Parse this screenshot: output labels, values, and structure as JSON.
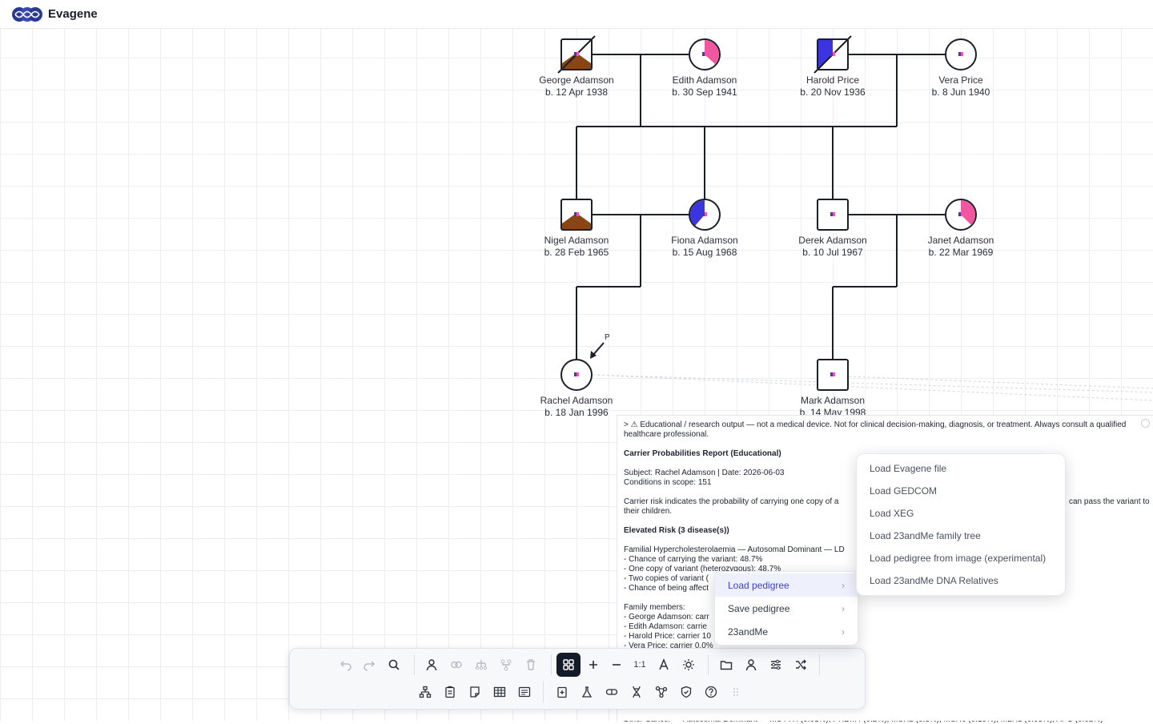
{
  "app": {
    "title": "Evagene"
  },
  "colors": {
    "accent": "#3a3fcf",
    "carrier_blue": "#3b35e0",
    "carrier_pink": "#f0579e",
    "affected_brown": "#8a4514",
    "line": "#1b1f2a"
  },
  "pedigree": {
    "people": [
      {
        "name": "George Adamson",
        "birth": "b. 12 Apr 1938"
      },
      {
        "name": "Edith Adamson",
        "birth": "b. 30 Sep 1941"
      },
      {
        "name": "Harold Price",
        "birth": "b. 20 Nov 1936"
      },
      {
        "name": "Vera Price",
        "birth": "b. 8 Jun 1940"
      },
      {
        "name": "Nigel Adamson",
        "birth": "b. 28 Feb 1965"
      },
      {
        "name": "Fiona Adamson",
        "birth": "b. 15 Aug 1968"
      },
      {
        "name": "Derek Adamson",
        "birth": "b. 10 Jul 1967"
      },
      {
        "name": "Janet Adamson",
        "birth": "b. 22 Mar 1969"
      },
      {
        "name": "Rachel Adamson",
        "birth": "b. 18 Jan 1996"
      },
      {
        "name": "Mark Adamson",
        "birth": "b. 14 May 1998"
      }
    ],
    "proband_marker": "P"
  },
  "report": {
    "disclaimer": "> ⚠ Educational / research output — not a medical device. Not for clinical decision-making, diagnosis, or treatment. Always consult a qualified healthcare professional.",
    "title": "Carrier Probabilities Report (Educational)",
    "subject": "Subject: Rachel Adamson | Date: 2026-06-03",
    "scope": "Conditions in scope: 151",
    "explain_1": "Carrier risk indicates the probability of carrying one copy of a",
    "explain_2": "can pass the variant to",
    "explain_3": "their children.",
    "elevated": "Elevated Risk (3 disease(s))",
    "fh_line": "Familial Hypercholesterolaemia — Autosomal Dominant — LD",
    "fh_1": "- Chance of carrying the variant: 48.7%",
    "fh_2": "- One copy of variant (heterozygous): 48.7%",
    "fh_3": "- Two copies of variant (",
    "fh_4": "- Chance of being affect",
    "fam_title": "Family members:",
    "fam_1": "- George Adamson: carr",
    "fam_2": "- Edith Adamson: carrie",
    "fam_3": "- Harold Price: carrier 10",
    "fam_4": "- Vera Price: carrier 0.0%",
    "bottom": "Other Cancer — Autosomal Dominant — MUTYH (0.01%), PRDM4 (0.2%), MSH2 (0.3%), MSH6 (0.19%), MLH1 (0.03%), APC (0.02%)"
  },
  "menu": {
    "items": [
      {
        "label": "Load pedigree",
        "chevron": "›"
      },
      {
        "label": "Save pedigree",
        "chevron": "›"
      },
      {
        "label": "23andMe",
        "chevron": "›"
      }
    ],
    "flyout": [
      "Load Evagene file",
      "Load GEDCOM",
      "Load XEG",
      "Load 23andMe family tree",
      "Load pedigree from image (experimental)",
      "Load 23andMe DNA Relatives"
    ]
  },
  "toolbar": {
    "zoom_reset_label": "1:1",
    "icons_row1": [
      "undo-icon",
      "redo-icon",
      "search-icon",
      "add-person-icon",
      "link-partners-icon",
      "add-children-icon",
      "add-parents-icon",
      "delete-icon",
      "layout-grid-icon",
      "zoom-in-icon",
      "zoom-out-icon",
      "zoom-reset",
      "text-size-icon",
      "theme-icon",
      "folder-icon",
      "profile-icon",
      "sliders-icon",
      "shuffle-icon"
    ],
    "icons_row2": [
      "tree-icon",
      "clipboard-icon",
      "note-icon",
      "table-icon",
      "list-icon",
      "report-icon",
      "flask-icon",
      "pill-icon",
      "dna-icon",
      "network-icon",
      "shield-icon",
      "help-icon",
      "drag-handle-icon"
    ]
  }
}
